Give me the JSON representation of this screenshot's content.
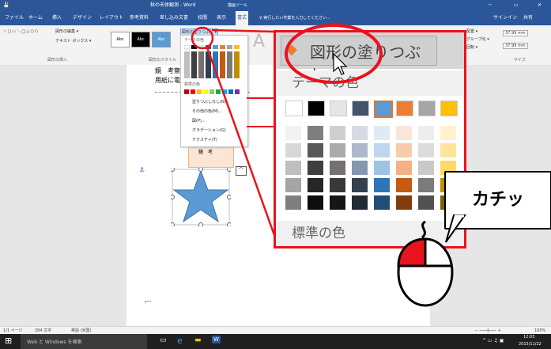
{
  "titlebar": {
    "doc_title": "秋の天体観測 - Word",
    "tool_context": "描画ツール"
  },
  "tabs": [
    "ファイル",
    "ホーム",
    "挿入",
    "デザイン",
    "レイアウト",
    "参考資料",
    "差し込み文書",
    "校閲",
    "表示",
    "書式"
  ],
  "tell_me": "♀ 実行したい作業を入力してください...",
  "account": {
    "signin": "サインイン",
    "share": "共有"
  },
  "ribbon": {
    "shape_edit": "図形の編集 ▾",
    "textbox": "テキスト ボックス ▾",
    "insert_group": "図形の挿入",
    "style_group": "図形のスタイル",
    "fill_button": "図形の塗りつぶし ▾",
    "styles": [
      "Abc",
      "Abc",
      "Abc"
    ],
    "arrange_label": "配置 ▾",
    "group_label": "グループ化 ▾",
    "rotate_label": "回転 ▾",
    "height": "37.99 mm",
    "width": "37.99 mm",
    "size_group": "サイズ"
  },
  "dropdown": {
    "theme_label": "テーマの色",
    "standard_label": "標準の色",
    "no_fill": "塗りつぶしなし(N)",
    "more_colors": "その他の色(M)...",
    "picture": "図(P)...",
    "gradient": "グラデーション(G)",
    "texture": "テクスチャ(T)"
  },
  "zoom": {
    "fill_title": "図形の塗りつぶし ▾",
    "theme_label": "テーマの色",
    "standard_label": "標準の色",
    "theme_top": [
      "#ffffff",
      "#000000",
      "#e7e6e6",
      "#44546a",
      "#5b9bd5",
      "#ed7d31",
      "#a5a5a5",
      "#ffc000"
    ],
    "columns": [
      [
        "#f2f2f2",
        "#d8d8d8",
        "#bfbfbf",
        "#a5a5a5",
        "#7f7f7f"
      ],
      [
        "#7f7f7f",
        "#595959",
        "#3f3f3f",
        "#262626",
        "#0d0d0d"
      ],
      [
        "#d0cece",
        "#aeaaaa",
        "#757171",
        "#3a3838",
        "#171616"
      ],
      [
        "#d6dce4",
        "#adb9ca",
        "#8496b0",
        "#333f4f",
        "#222a35"
      ],
      [
        "#deebf6",
        "#bdd7ee",
        "#9cc3e5",
        "#2e75b5",
        "#1f4e79"
      ],
      [
        "#fbe5d5",
        "#f7cbac",
        "#f4b183",
        "#c55a11",
        "#833c0b"
      ],
      [
        "#ededed",
        "#dbdbdb",
        "#c9c9c9",
        "#7b7b7b",
        "#525252"
      ],
      [
        "#fff2cc",
        "#fee599",
        "#ffd966",
        "#bf8f00",
        "#7f6000"
      ]
    ]
  },
  "document": {
    "line1": "鏡　考察",
    "line2": "用紙に電",
    "label_small": "鏡　考"
  },
  "callout": {
    "text": "カチッ"
  },
  "status": {
    "page": "1/1 ページ",
    "words": "284 文字",
    "lang": "英語 (米国)",
    "zoom": "100%"
  },
  "taskbar": {
    "search": "Web と Windows を検索",
    "time": "12:03",
    "date": "2015/11/22"
  },
  "colors": {
    "accent": "#2b579a",
    "highlight_red": "#e8131e",
    "shape_blue": "#5b9bd5"
  }
}
